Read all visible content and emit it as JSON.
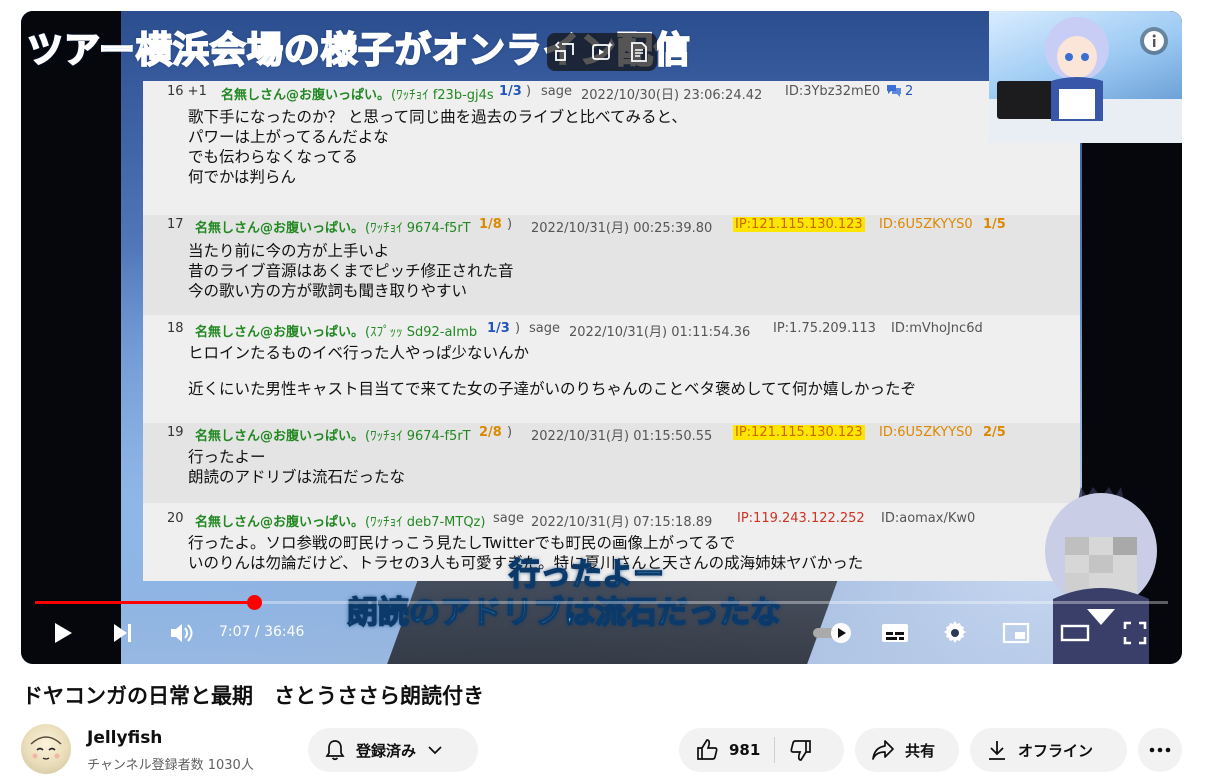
{
  "player": {
    "headline": "ツアー横浜会場の様子がオンライン配信",
    "subtitle_lines": [
      "行ったよー",
      "朗読のアドリブは流石だったな"
    ],
    "time_current": "7:07",
    "time_total": "36:46",
    "time_separator": " / ",
    "progress_fraction": 0.193
  },
  "thread": {
    "posts": [
      {
        "num": "16 +1",
        "name": "名無しさん@お腹いっぱい。",
        "trip": "(ﾜｯﾁｮｲ f23b-gj4s",
        "count": "1/3",
        "close": ")",
        "mail": "sage",
        "date": "2022/10/30(日) 23:06:24.42",
        "ip": "",
        "id": "ID:3Ybz32mE0",
        "id_count": "",
        "reply_count": "2",
        "body": [
          "歌下手になったのか？ と思って同じ曲を過去のライブと比べてみると、",
          "パワーは上がってるんだよな",
          "でも伝わらなくなってる",
          "何でかは判らん"
        ]
      },
      {
        "num": "17",
        "name": "名無しさん@お腹いっぱい。",
        "trip": "(ﾜｯﾁｮｲ 9674-f5rT",
        "count": "1/8",
        "close": ")",
        "mail": "",
        "date": "2022/10/31(月) 00:25:39.80",
        "ip": "IP:121.115.130.123",
        "id": "ID:6U5ZKYYS0",
        "id_count": "1/5",
        "reply_count": "",
        "body": [
          "当たり前に今の方が上手いよ",
          "昔のライブ音源はあくまでピッチ修正された音",
          "今の歌い方の方が歌詞も聞き取りやすい"
        ]
      },
      {
        "num": "18",
        "name": "名無しさん@お腹いっぱい。",
        "trip": "(ｽﾌﾟｯｯ Sd92-aImb",
        "count": "1/3",
        "close": ")",
        "mail": "sage",
        "date": "2022/10/31(月) 01:11:54.36",
        "ip": "IP:1.75.209.113",
        "id": "ID:mVhoJnc6d",
        "id_count": "",
        "reply_count": "",
        "body": [
          "ヒロインたるものイベ行った人やっぱ少ないんか",
          "",
          "近くにいた男性キャスト目当てで来てた女の子達がいのりちゃんのことベタ褒めしてて何か嬉しかったぞ"
        ]
      },
      {
        "num": "19",
        "name": "名無しさん@お腹いっぱい。",
        "trip": "(ﾜｯﾁｮｲ 9674-f5rT",
        "count": "2/8",
        "close": ")",
        "mail": "",
        "date": "2022/10/31(月) 01:15:50.55",
        "ip": "IP:121.115.130.123",
        "id": "ID:6U5ZKYYS0",
        "id_count": "2/5",
        "reply_count": "",
        "body": [
          "行ったよー",
          "朗読のアドリブは流石だったな"
        ]
      },
      {
        "num": "20",
        "name": "名無しさん@お腹いっぱい。",
        "trip": "(ﾜｯﾁｮｲ deb7-MTQz)",
        "count": "",
        "close": "",
        "mail": "sage",
        "date": "2022/10/31(月) 07:15:18.89",
        "ip": "IP:119.243.122.252",
        "id": "ID:aomax/Kw0",
        "id_count": "",
        "reply_count": "",
        "body": [
          "行ったよ。ソロ参戦の町民けっこう見たしTwitterでも町民の画像上がってるで",
          "いのりんは勿論だけど、トラセの3人も可愛すぎた。特に夏川さんと天さんの成海姉妹ヤバかった"
        ]
      }
    ]
  },
  "video": {
    "title": "ドヤコンガの日常と最期　さとうささら朗読付き"
  },
  "channel": {
    "name": "Jellyfish",
    "subscribers": "チャンネル登録者数 1030人",
    "subscribe_label": "登録済み"
  },
  "actions": {
    "like_count": "981",
    "share_label": "共有",
    "offline_label": "オフライン"
  },
  "colors": {
    "progress": "#ff0000",
    "pill_bg": "#f2f2f2",
    "headline": "#2d7df5",
    "ip_highlight": "#ffe600"
  }
}
